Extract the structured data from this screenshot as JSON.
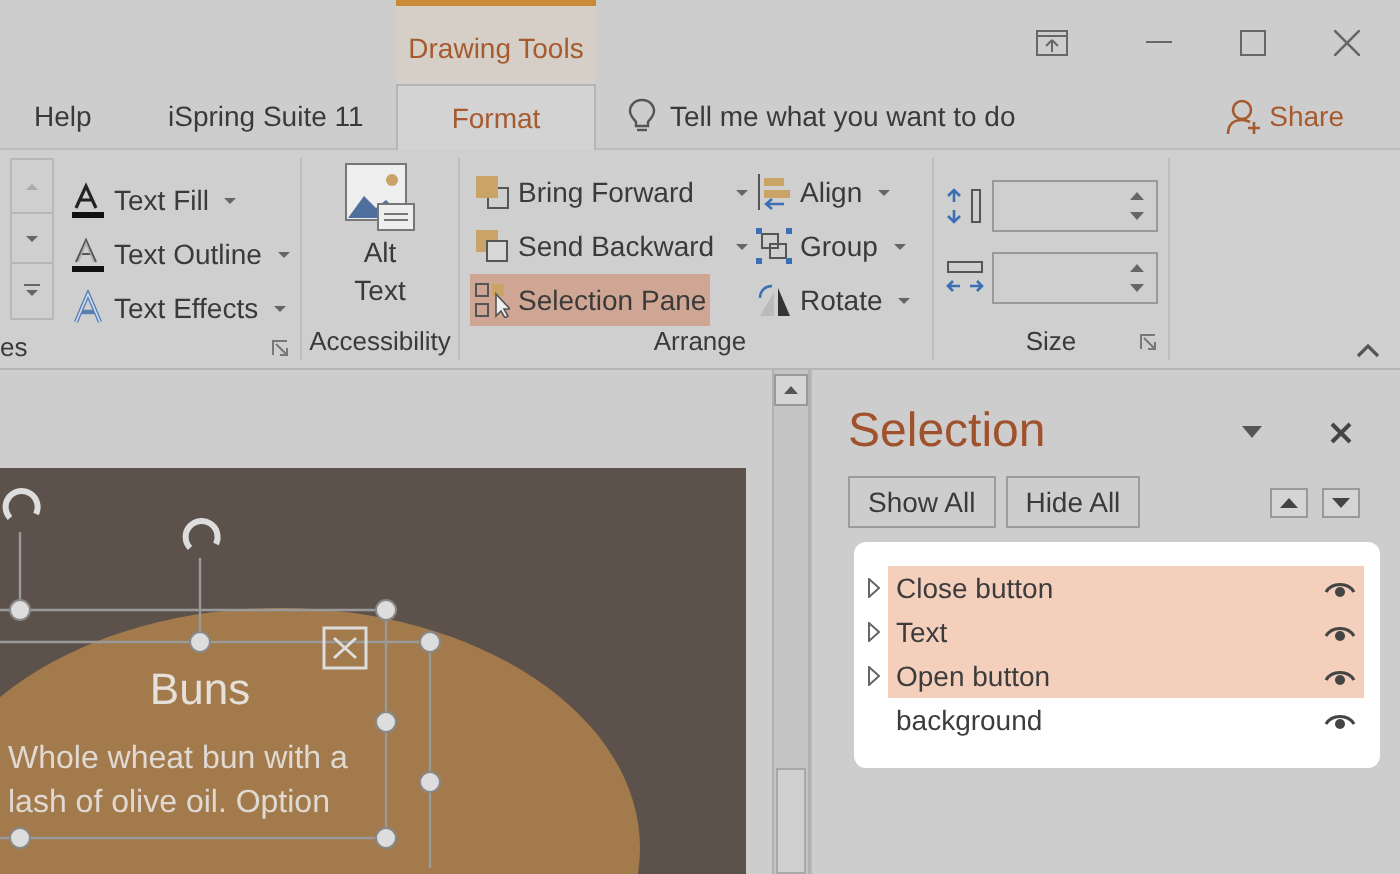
{
  "title_bar": {
    "context_tab": "Drawing Tools"
  },
  "tabs": [
    {
      "label": "Help",
      "selected": false
    },
    {
      "label": "iSpring Suite 11",
      "selected": false
    },
    {
      "label": "Format",
      "selected": true
    }
  ],
  "tell_me": {
    "placeholder": "Tell me what you want to do"
  },
  "share": "Share",
  "ribbon": {
    "groups": [
      {
        "kind": "wordart",
        "label": "es",
        "items": [
          {
            "label": "Text Fill"
          },
          {
            "label": "Text Outline"
          },
          {
            "label": "Text Effects"
          }
        ]
      },
      {
        "kind": "accessibility",
        "label": "Accessibility",
        "items": [
          {
            "label": "Alt\nText"
          }
        ]
      },
      {
        "kind": "arrange",
        "label": "Arrange",
        "items": [
          {
            "label": "Bring Forward",
            "selected": false
          },
          {
            "label": "Send Backward",
            "selected": false
          },
          {
            "label": "Selection Pane",
            "selected": true
          },
          {
            "label": "Align",
            "selected": false
          },
          {
            "label": "Group",
            "selected": false
          },
          {
            "label": "Rotate",
            "selected": false
          }
        ]
      },
      {
        "kind": "size",
        "label": "Size"
      }
    ]
  },
  "slide": {
    "title": "Buns",
    "body_lines": [
      "Whole wheat bun with a",
      "lash of olive oil. Option"
    ]
  },
  "selection_pane": {
    "title": "Selection",
    "buttons": [
      "Show All",
      "Hide All"
    ],
    "items": [
      {
        "label": "Close button",
        "selected": true,
        "expandable": true
      },
      {
        "label": "Text",
        "selected": true,
        "expandable": true
      },
      {
        "label": "Open button",
        "selected": true,
        "expandable": true
      },
      {
        "label": "background",
        "selected": false,
        "expandable": false
      }
    ]
  }
}
